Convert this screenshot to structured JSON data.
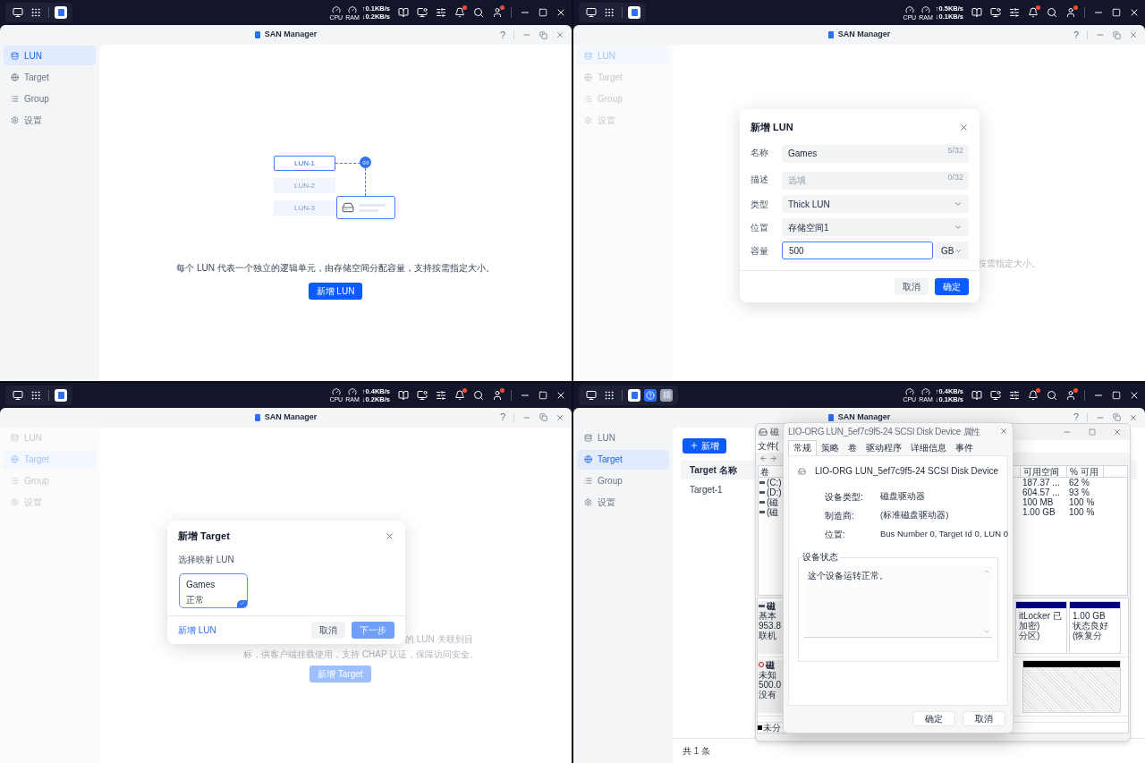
{
  "panels": [
    {
      "taskbar": {
        "apps": [
          {
            "kind": "san"
          }
        ],
        "cpu": "CPU",
        "ram": "RAM",
        "upload": "↑0.1KB/s",
        "download": "↓0.2KB/s",
        "bell_badge": true,
        "user_badge": true
      },
      "window": {
        "title": "SAN Manager",
        "help": "?"
      },
      "sidebar": [
        {
          "kind": "lun",
          "label": "LUN",
          "selected": true
        },
        {
          "kind": "target",
          "label": "Target",
          "selected": false
        },
        {
          "kind": "group",
          "label": "Group",
          "selected": false
        },
        {
          "kind": "settings",
          "label": "设置",
          "selected": false
        }
      ],
      "content": {
        "kind": "empty",
        "diagram": [
          "LUN-1",
          "LUN-2",
          "LUN-3"
        ],
        "description": "每个 LUN 代表一个独立的逻辑单元，由存储空间分配容量，支持按需指定大小。",
        "button": "新增 LUN"
      }
    },
    {
      "taskbar": {
        "apps": [
          {
            "kind": "san"
          }
        ],
        "cpu": "CPU",
        "ram": "RAM",
        "upload": "↑0.5KB/s",
        "download": "↓0.1KB/s",
        "bell_badge": true,
        "user_badge": true
      },
      "window": {
        "title": "SAN Manager",
        "help": "?"
      },
      "sidebar": [
        {
          "kind": "lun",
          "label": "LUN",
          "selected": true
        },
        {
          "kind": "target",
          "label": "Target",
          "selected": false
        },
        {
          "kind": "group",
          "label": "Group",
          "selected": false
        },
        {
          "kind": "settings",
          "label": "设置",
          "selected": false
        }
      ],
      "content": {
        "kind": "lun_covered",
        "tail": "按需指定大小。"
      },
      "dialog": {
        "kind": "new_lun",
        "title": "新增 LUN",
        "fields": [
          {
            "kind": "text",
            "label": "名称",
            "value": "Games",
            "counter": "5/32",
            "focused": false
          },
          {
            "kind": "text",
            "label": "描述",
            "placeholder": "选填",
            "counter": "0/32",
            "focused": false
          },
          {
            "kind": "select",
            "label": "类型",
            "value": "Thick LUN",
            "focused": false
          },
          {
            "kind": "select",
            "label": "位置",
            "value": "存储空间1",
            "focused": false
          },
          {
            "kind": "unit",
            "label": "容量",
            "value": "500",
            "unit": "GB",
            "focused": true
          }
        ],
        "buttons": [
          {
            "label": "取消",
            "kind": "secondary",
            "disabled": false
          },
          {
            "label": "确定",
            "kind": "primary",
            "disabled": false
          }
        ]
      }
    },
    {
      "taskbar": {
        "apps": [
          {
            "kind": "san"
          }
        ],
        "cpu": "CPU",
        "ram": "RAM",
        "upload": "↑0.4KB/s",
        "download": "↓0.2KB/s",
        "bell_badge": true,
        "user_badge": true
      },
      "window": {
        "title": "SAN Manager",
        "help": "?"
      },
      "sidebar": [
        {
          "kind": "lun",
          "label": "LUN",
          "selected": false
        },
        {
          "kind": "target",
          "label": "Target",
          "selected": true
        },
        {
          "kind": "group",
          "label": "Group",
          "selected": false
        },
        {
          "kind": "settings",
          "label": "设置",
          "selected": false
        }
      ],
      "content": {
        "kind": "target_covered",
        "tail": "的 LUN 关联到目",
        "line": "标，供客户端挂载使用，支持 CHAP 认证，保障访问安全。",
        "button": "新增 Target"
      },
      "dialog": {
        "kind": "new_target",
        "title": "新增 Target",
        "label": "选择映射 LUN",
        "cards": [
          {
            "name": "Games",
            "status": "正常",
            "selected": true
          }
        ],
        "link": "新增 LUN",
        "buttons": [
          {
            "label": "取消",
            "kind": "secondary",
            "disabled": false
          },
          {
            "label": "下一步",
            "kind": "primary",
            "disabled": true
          }
        ]
      }
    },
    {
      "taskbar": {
        "apps": [
          {
            "kind": "san"
          },
          {
            "kind": "help"
          },
          {
            "kind": "disk"
          }
        ],
        "cpu": "CPU",
        "ram": "RAM",
        "upload": "↑0.4KB/s",
        "download": "↓0.1KB/s",
        "bell_badge": true,
        "user_badge": true
      },
      "window": {
        "title": "SAN Manager",
        "help": "?"
      },
      "sidebar": [
        {
          "kind": "lun",
          "label": "LUN",
          "selected": false
        },
        {
          "kind": "target",
          "label": "Target",
          "selected": true
        },
        {
          "kind": "group",
          "label": "Group",
          "selected": false
        },
        {
          "kind": "settings",
          "label": "设置",
          "selected": false
        }
      ],
      "content": {
        "kind": "table",
        "add_button": "新增",
        "column": "Target 名称",
        "rows": [
          "Target-1"
        ],
        "footer": "共 1 条"
      },
      "disk_window": {
        "title": "磁",
        "menu": "文件(",
        "columns": [
          "卷",
          "可用空间",
          "% 可用"
        ],
        "volumes": [
          {
            "name": "(C:)",
            "free": "187.37 ...",
            "percent": "62 %"
          },
          {
            "name": "(D:)",
            "free": "604.57 ...",
            "percent": "93 %"
          },
          {
            "name": "(磁",
            "free": "100 MB",
            "percent": "100 %"
          },
          {
            "name": "(磁",
            "free": "1.00 GB",
            "percent": "100 %"
          }
        ],
        "disks": [
          {
            "kind": "online",
            "lines": [
              "磁",
              "基本",
              "953.8",
              "联机"
            ],
            "partitions": [
              {
                "kind": "primary",
                "lines": [
                  "itLocker 已加密)",
                  "分区)"
                ]
              },
              {
                "kind": "primary",
                "lines": [
                  "1.00 GB",
                  "状态良好 (恢复分"
                ]
              }
            ]
          },
          {
            "kind": "unknown",
            "lines": [
              "磁",
              "未知",
              "500.0",
              "没有"
            ],
            "partitions": [
              {
                "kind": "unallocated"
              }
            ]
          }
        ],
        "legend": "未分"
      },
      "properties": {
        "title": "LIO-ORG LUN_5ef7c9f5-24 SCSI Disk Device 属性",
        "tabs": [
          {
            "label": "常规",
            "selected": true
          },
          {
            "label": "策略",
            "selected": false
          },
          {
            "label": "卷",
            "selected": false
          },
          {
            "label": "驱动程序",
            "selected": false
          },
          {
            "label": "详细信息",
            "selected": false
          },
          {
            "label": "事件",
            "selected": false
          }
        ],
        "device": "LIO-ORG LUN_5ef7c9f5-24 SCSI Disk Device",
        "fields": [
          {
            "label": "设备类型:",
            "value": "磁盘驱动器"
          },
          {
            "label": "制造商:",
            "value": "(标准磁盘驱动器)"
          },
          {
            "label": "位置:",
            "value": "Bus Number 0, Target Id 0, LUN 0"
          }
        ],
        "status_title": "设备状态",
        "status": "这个设备运转正常。",
        "buttons": [
          "确定",
          "取消"
        ]
      }
    }
  ]
}
